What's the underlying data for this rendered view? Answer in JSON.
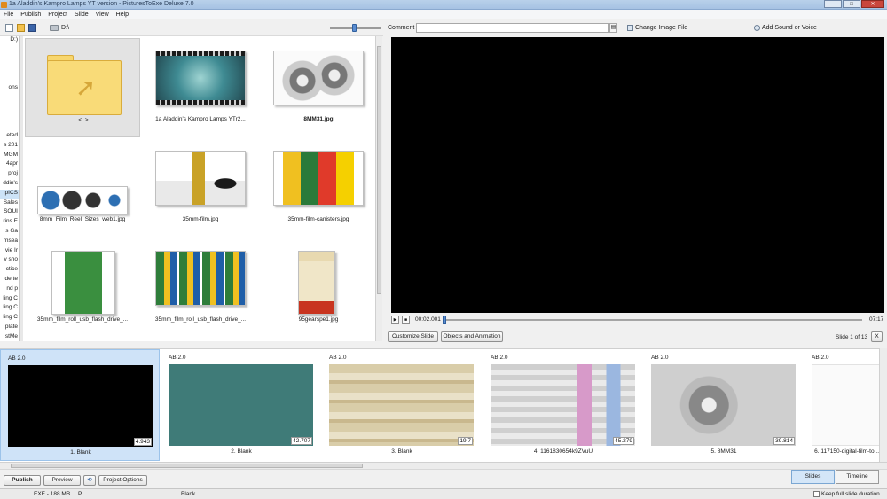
{
  "window": {
    "title": "1a Aladdin's Kampro Lamps YT version - PicturesToExe Deluxe 7.0",
    "buttons": [
      "–",
      "□",
      "✕"
    ]
  },
  "menu": [
    "File",
    "Publish",
    "Project",
    "Slide",
    "View",
    "Help"
  ],
  "toolbar": {
    "path": "D:\\"
  },
  "tree": [
    "D:)",
    "",
    "",
    "",
    "",
    "ons",
    "",
    "",
    "",
    "",
    "eted",
    "s 201",
    "MGM",
    "4apr",
    "proj",
    "ddin's",
    "pICS",
    "Sales",
    "SOUI",
    "rins E",
    "s Ga",
    "rnsea",
    "vie Ir",
    "v sho",
    "ctice",
    "de te",
    "nd p",
    "ling C",
    "ling C",
    "ling C",
    "plate",
    "stMe"
  ],
  "browser": {
    "items": [
      {
        "label": "<..>",
        "type": "folder"
      },
      {
        "label": "1a Aladdin's Kampro Lamps YTr2...",
        "type": "image"
      },
      {
        "label": "8MM31.jpg",
        "type": "image"
      },
      {
        "label": "8mm_Film_Reel_Sizes_web1.jpg",
        "type": "image"
      },
      {
        "label": "35mm-film.jpg",
        "type": "image"
      },
      {
        "label": "35mm-film-canisters.jpg",
        "type": "image"
      },
      {
        "label": "35mm_film_roll_usb_flash_drive_...",
        "type": "image"
      },
      {
        "label": "35mm_film_roll_usb_flash_drive_...",
        "type": "image"
      },
      {
        "label": "95gearspe1.jpg",
        "type": "image"
      }
    ]
  },
  "editor": {
    "comment_label": "Comment",
    "change_image": "Change Image File",
    "add_sound": "Add Sound or Voice",
    "time_current": "00:02.001",
    "time_total": "07:17",
    "customize_slide": "Customize Slide",
    "objects_animation": "Objects and Animation",
    "slide_of": "Slide 1 of 13",
    "close_label": "X"
  },
  "slides": [
    {
      "meta": "AB  2.0",
      "duration": "4.943",
      "caption": "1. Blank"
    },
    {
      "meta": "AB  2.0",
      "duration": "42.707",
      "caption": "2. Blank"
    },
    {
      "meta": "AB  2.0",
      "duration": "19.7",
      "caption": "3. Blank"
    },
    {
      "meta": "AB  2.0",
      "duration": "45.279",
      "caption": "4. 1161830654k9ZVuU"
    },
    {
      "meta": "AB  2.0",
      "duration": "39.814",
      "caption": "5. 8MM31"
    },
    {
      "meta": "AB  2.0",
      "duration": "",
      "caption": "6. 117150-digital-film-to..."
    }
  ],
  "bottom": {
    "publish": "Publish",
    "preview": "Preview",
    "project_options": "Project Options",
    "tab_slides": "Slides",
    "tab_timeline": "Timeline"
  },
  "status": {
    "exe": "EXE - 188 MB",
    "p": "P",
    "name": "Blank",
    "keep_full": "Keep full slide duration"
  }
}
